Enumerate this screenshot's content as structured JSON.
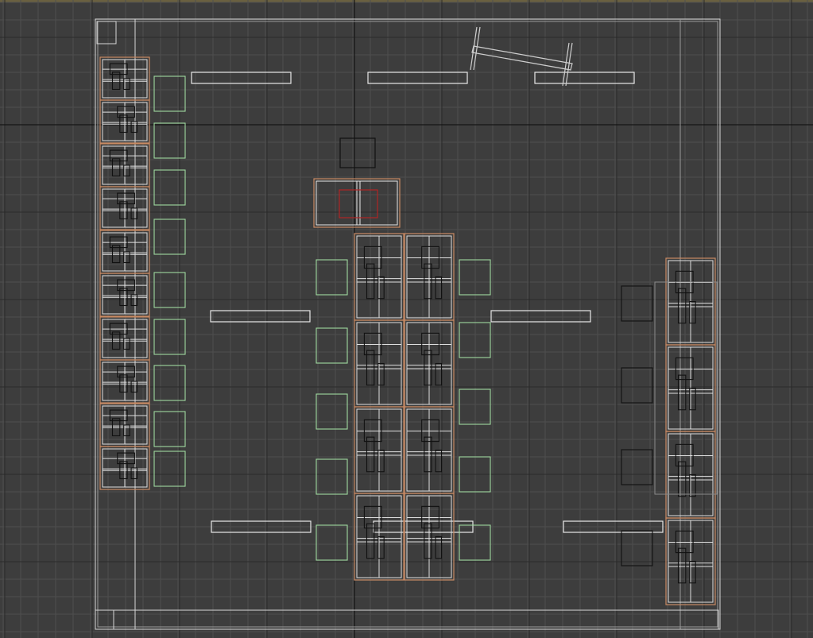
{
  "viewport": {
    "name": "top-orthographic-viewport",
    "colors": {
      "background": "#3d3d3d",
      "grid_minor": "#4e4e4e",
      "grid_major": "#1e1e1e",
      "wire_white": "#d8d8d8",
      "wire_orange": "#c98a63",
      "wire_green": "#9fd99f",
      "wire_black": "#111111",
      "wire_red": "#b02525",
      "top_strip": "#6a6040"
    }
  }
}
